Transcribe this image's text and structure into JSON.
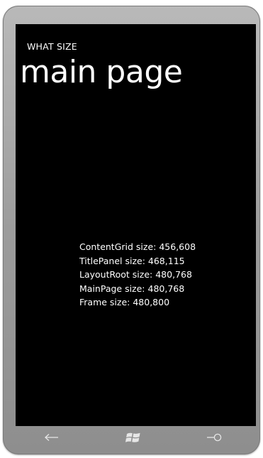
{
  "app": {
    "title": "WHAT SIZE",
    "page_title": "main page"
  },
  "sizes": [
    "ContentGrid size: 456,608",
    "TitlePanel size: 468,115",
    "LayoutRoot size: 480,768",
    "MainPage size: 480,768",
    "Frame size: 480,800"
  ],
  "hardware_buttons": {
    "back": "back-arrow-icon",
    "start": "windows-logo-icon",
    "search": "search-icon"
  },
  "colors": {
    "screen_bg": "#000000",
    "text": "#ffffff",
    "bezel": "#9c9c9c",
    "icons": "#e6e6e6"
  }
}
